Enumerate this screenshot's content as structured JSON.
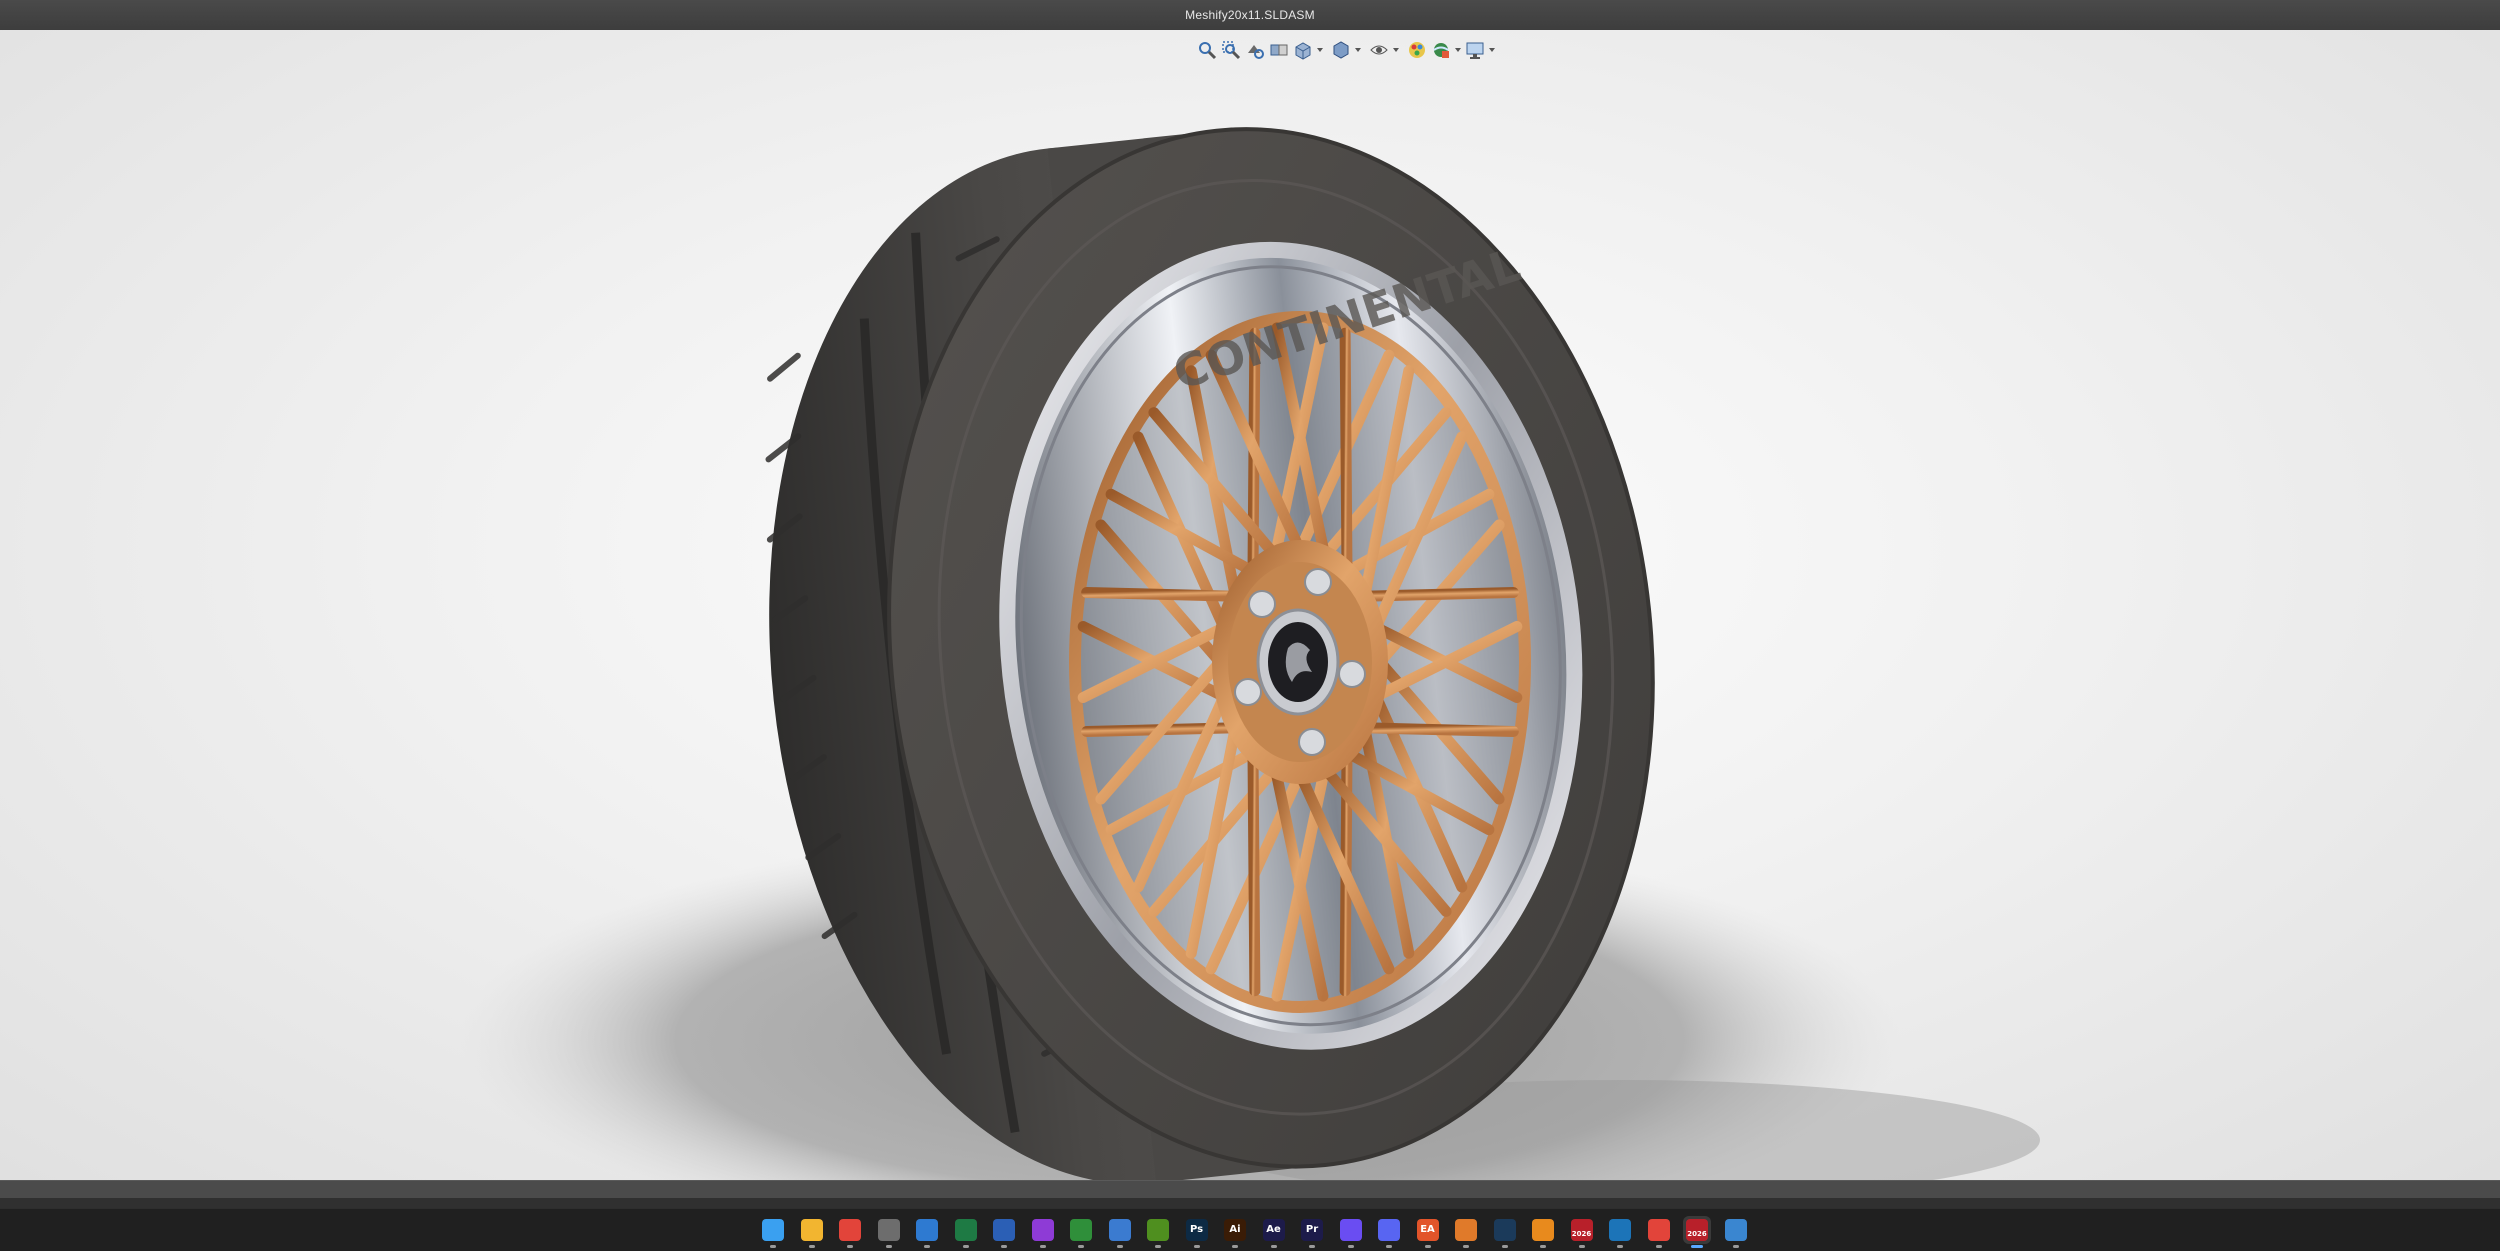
{
  "window": {
    "title": "Meshify20x11.SLDASM"
  },
  "view_toolbar": {
    "buttons": [
      {
        "name": "zoom-to-fit-icon"
      },
      {
        "name": "zoom-to-area-icon"
      },
      {
        "name": "previous-view-icon"
      },
      {
        "name": "section-view-icon"
      },
      {
        "name": "view-orientation-icon"
      },
      {
        "name": "display-style-icon"
      },
      {
        "name": "hide-show-items-icon"
      },
      {
        "name": "edit-appearance-icon"
      },
      {
        "name": "apply-scene-icon"
      },
      {
        "name": "view-settings-icon"
      }
    ]
  },
  "model": {
    "tire_sidewall_text": "CONTINENTAL",
    "colors": {
      "tire": "#4a4846",
      "rim_spokes": "#c98a52",
      "lip": "#d9d9de",
      "background": "#f2f2f2"
    }
  },
  "taskbar": {
    "apps": [
      {
        "name": "windows-start-icon",
        "label": "",
        "color": "#3aa0f0",
        "active": false
      },
      {
        "name": "file-explorer-icon",
        "label": "",
        "color": "#f2b530",
        "active": false
      },
      {
        "name": "chrome-icon",
        "label": "",
        "color": "#e2443a",
        "active": false
      },
      {
        "name": "calculator-icon",
        "label": "",
        "color": "#6d6d6d",
        "active": false
      },
      {
        "name": "microsoft-store-icon",
        "label": "",
        "color": "#2e7ad1",
        "active": false
      },
      {
        "name": "excel-icon",
        "label": "",
        "color": "#1e7a44",
        "active": false
      },
      {
        "name": "word-icon",
        "label": "",
        "color": "#2b5fb5",
        "active": false
      },
      {
        "name": "camera-app-icon",
        "label": "",
        "color": "#8e3bd6",
        "active": false
      },
      {
        "name": "xbox-icon",
        "label": "",
        "color": "#2f8f3a",
        "active": false
      },
      {
        "name": "notepad-icon",
        "label": "",
        "color": "#3b7bd0",
        "active": false
      },
      {
        "name": "nvidia-icon",
        "label": "",
        "color": "#4f8f1f",
        "active": false
      },
      {
        "name": "photoshop-icon",
        "label": "Ps",
        "color": "#0d2a44",
        "active": false
      },
      {
        "name": "illustrator-icon",
        "label": "Ai",
        "color": "#3a1c06",
        "active": false
      },
      {
        "name": "after-effects-icon",
        "label": "Ae",
        "color": "#1d1b4a",
        "active": false
      },
      {
        "name": "premiere-icon",
        "label": "Pr",
        "color": "#1d1b4a",
        "active": false
      },
      {
        "name": "messenger-icon",
        "label": "",
        "color": "#6a4df2",
        "active": false
      },
      {
        "name": "discord-icon",
        "label": "",
        "color": "#5865f2",
        "active": false
      },
      {
        "name": "ea-app-icon",
        "label": "EA",
        "color": "#e2542a",
        "active": false
      },
      {
        "name": "fusion-icon",
        "label": "",
        "color": "#e07a2a",
        "active": false
      },
      {
        "name": "steam-icon",
        "label": "",
        "color": "#1b3a5a",
        "active": false
      },
      {
        "name": "blender-icon",
        "label": "",
        "color": "#e88a1d",
        "active": false
      },
      {
        "name": "solidworks-2026-icon",
        "label": "2026",
        "color": "#b8202a",
        "active": false
      },
      {
        "name": "sketchup-icon",
        "label": "",
        "color": "#1c74b8",
        "active": false
      },
      {
        "name": "chrome-profile-icon",
        "label": "",
        "color": "#e2443a",
        "active": false
      },
      {
        "name": "solidworks-2026-active-icon",
        "label": "2026",
        "color": "#b8202a",
        "active": true
      },
      {
        "name": "notes-icon",
        "label": "",
        "color": "#3a86d0",
        "active": false
      }
    ]
  }
}
